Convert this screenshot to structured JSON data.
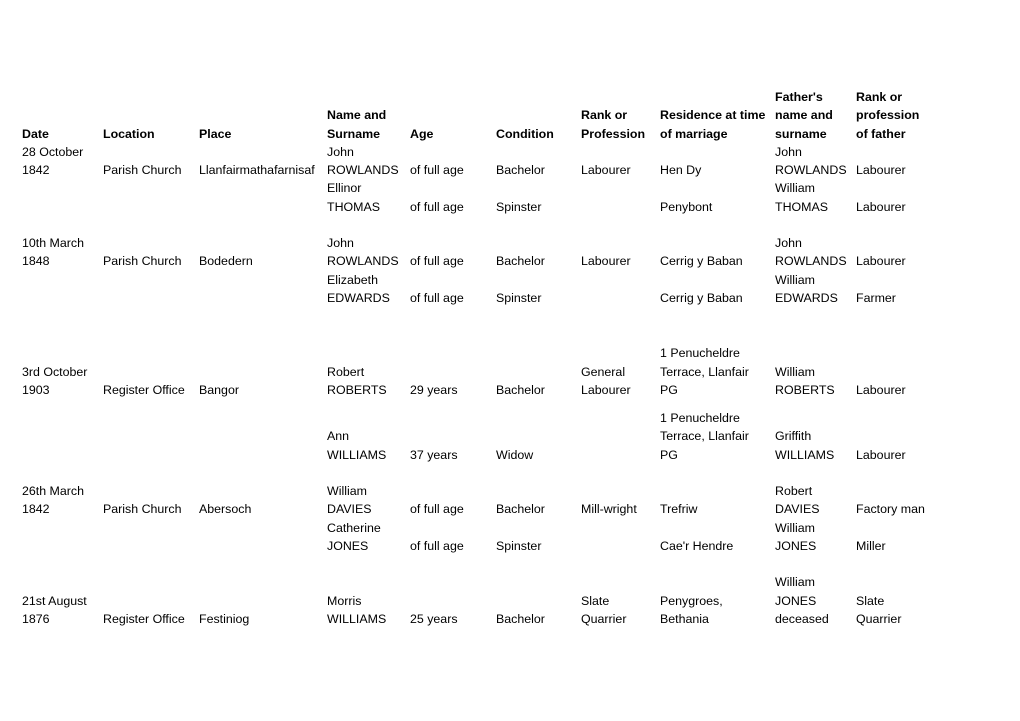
{
  "document": {
    "kind": "marriage-records-table",
    "text_color": "#000000",
    "background_color": "#ffffff"
  },
  "table": {
    "headers": [
      "Date",
      "Location",
      "Place",
      "Name and Surname",
      "Age",
      "Condition",
      "Rank or Profession",
      "Residence at time of marriage",
      "Father's name and surname",
      "Rank or profession of father"
    ],
    "records": [
      {
        "date": "28 October 1842",
        "location": "Parish Church",
        "place": "Llanfairmathafarnisaf",
        "parties": [
          {
            "name": "John ROWLANDS",
            "age": "of full age",
            "condition": "Bachelor",
            "rank": "Labourer",
            "residence": "Hen Dy",
            "father_name": "John ROWLANDS",
            "father_rank": "Labourer"
          },
          {
            "name": "Ellinor THOMAS",
            "age": "of full age",
            "condition": "Spinster",
            "rank": "",
            "residence": "Penybont",
            "father_name": "William THOMAS",
            "father_rank": "Labourer"
          }
        ]
      },
      {
        "date": "10th March 1848",
        "location": "Parish Church",
        "place": "Bodedern",
        "parties": [
          {
            "name": "John ROWLANDS",
            "age": "of full age",
            "condition": "Bachelor",
            "rank": "Labourer",
            "residence": "Cerrig y Baban",
            "father_name": "John ROWLANDS",
            "father_rank": "Labourer"
          },
          {
            "name": "Elizabeth EDWARDS",
            "age": "of full age",
            "condition": "Spinster",
            "rank": "",
            "residence": "Cerrig y Baban",
            "father_name": "William EDWARDS",
            "father_rank": "Farmer"
          }
        ]
      },
      {
        "date": "3rd October 1903",
        "location": "Register Office",
        "place": "Bangor",
        "parties": [
          {
            "name": "Robert ROBERTS",
            "age": "29 years",
            "condition": "Bachelor",
            "rank": "General Labourer",
            "residence": "1 Penucheldre Terrace, Llanfair PG",
            "father_name": "William ROBERTS",
            "father_rank": "Labourer"
          },
          {
            "name": "Ann WILLIAMS",
            "age": "37 years",
            "condition": "Widow",
            "rank": "",
            "residence": "1 Penucheldre Terrace, Llanfair PG",
            "father_name": "Griffith WILLIAMS",
            "father_rank": "Labourer"
          }
        ]
      },
      {
        "date": "26th March 1842",
        "location": "Parish Church",
        "place": "Abersoch",
        "parties": [
          {
            "name": "William DAVIES",
            "age": "of full age",
            "condition": "Bachelor",
            "rank": "Mill-wright",
            "residence": "Trefriw",
            "father_name": "Robert DAVIES",
            "father_rank": "Factory man"
          },
          {
            "name": "Catherine JONES",
            "age": "of full age",
            "condition": "Spinster",
            "rank": "",
            "residence": "Cae'r Hendre",
            "father_name": "William JONES",
            "father_rank": "Miller"
          }
        ]
      },
      {
        "date": "21st August 1876",
        "location": "Register Office",
        "place": "Festiniog",
        "parties": [
          {
            "name": "Morris WILLIAMS",
            "age": "25 years",
            "condition": "Bachelor",
            "rank": "Slate Quarrier",
            "residence": "Penygroes, Bethania",
            "father_name": "William JONES deceased",
            "father_rank": "Slate Quarrier"
          }
        ]
      }
    ]
  }
}
